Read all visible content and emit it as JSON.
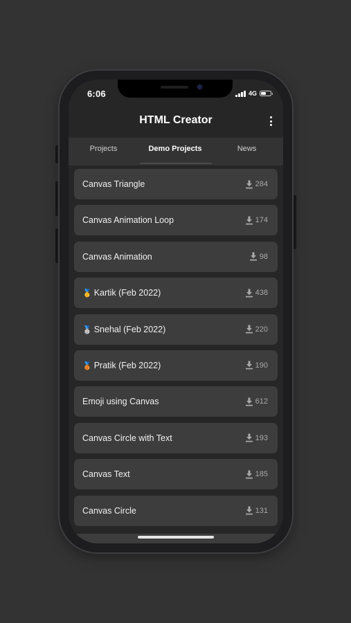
{
  "status_bar": {
    "time": "6:06",
    "network": "4G",
    "icons": [
      "signal-icon",
      "battery-icon"
    ]
  },
  "app_bar": {
    "title": "HTML Creator",
    "menu_icon": "more-vert-icon"
  },
  "tabs": [
    {
      "label": "Projects",
      "selected": false
    },
    {
      "label": "Demo Projects",
      "selected": true
    },
    {
      "label": "News",
      "selected": false
    }
  ],
  "items": [
    {
      "title": "Canvas Triangle",
      "medal": "",
      "downloads": "284"
    },
    {
      "title": "Canvas Animation Loop",
      "medal": "",
      "downloads": "174"
    },
    {
      "title": "Canvas Animation",
      "medal": "",
      "downloads": "98"
    },
    {
      "title": "Kartik (Feb 2022)",
      "medal": "🥇",
      "downloads": "438"
    },
    {
      "title": "Snehal (Feb 2022)",
      "medal": "🥈",
      "downloads": "220"
    },
    {
      "title": "Pratik (Feb 2022)",
      "medal": "🥉",
      "downloads": "190"
    },
    {
      "title": "Emoji using Canvas",
      "medal": "",
      "downloads": "612"
    },
    {
      "title": "Canvas Circle with Text",
      "medal": "",
      "downloads": "193"
    },
    {
      "title": "Canvas Text",
      "medal": "",
      "downloads": "185"
    },
    {
      "title": "Canvas Circle",
      "medal": "",
      "downloads": "131"
    }
  ],
  "icons": {
    "download": "download-icon"
  },
  "colors": {
    "background": "#333333",
    "card": "#3d3d3d",
    "screen": "#262626",
    "muted_text": "#a9a9a9"
  }
}
